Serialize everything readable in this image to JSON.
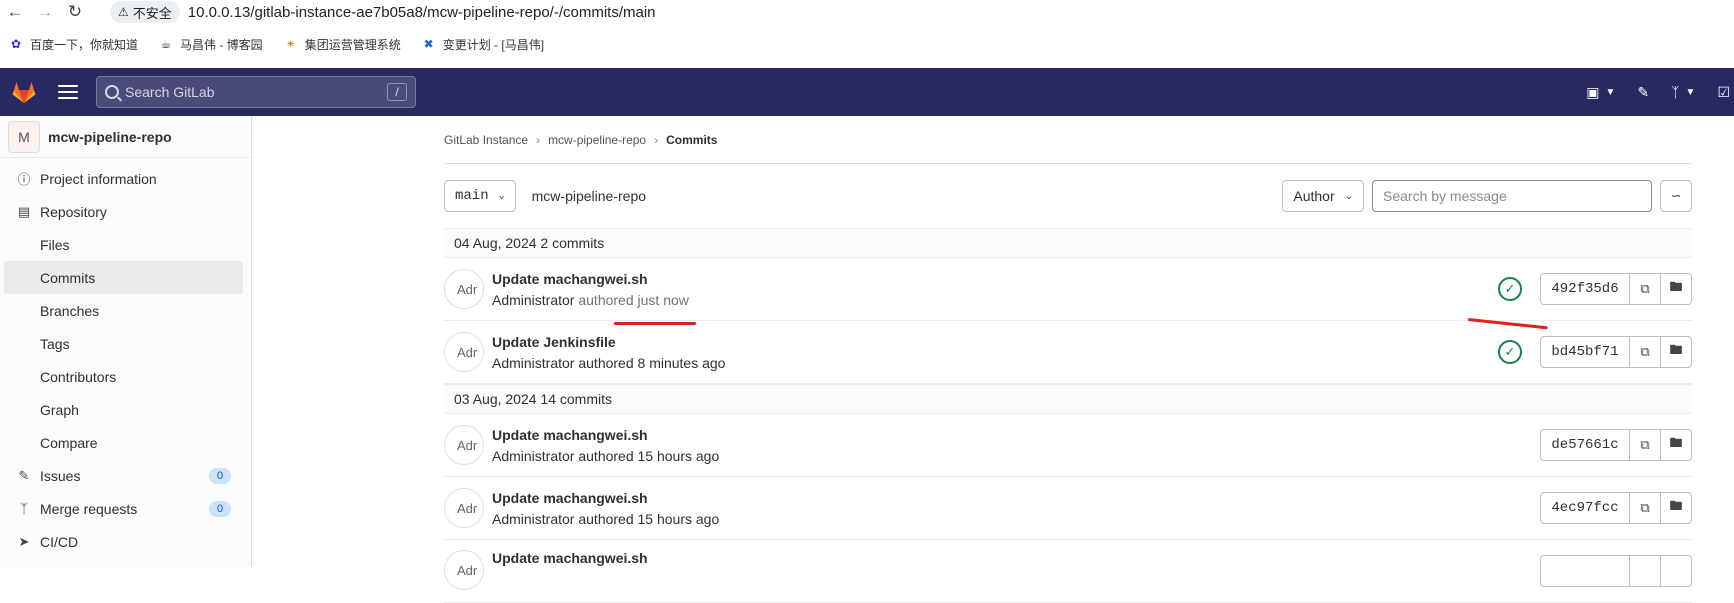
{
  "browser": {
    "insecure_label": "不安全",
    "url": "10.0.0.13/gitlab-instance-ae7b05a8/mcw-pipeline-repo/-/commits/main",
    "bookmarks": [
      {
        "label": "百度一下，你就知道",
        "icon": "baidu-paw-icon"
      },
      {
        "label": "马昌伟 - 博客园",
        "icon": "cnblogs-icon"
      },
      {
        "label": "集团运营管理系统",
        "icon": "sparkle-icon"
      },
      {
        "label": "变更计划 - [马昌伟]",
        "icon": "confluence-icon"
      }
    ]
  },
  "topbar": {
    "search_placeholder": "Search GitLab",
    "search_shortcut": "/"
  },
  "sidebar": {
    "project_initial": "M",
    "project_name": "mcw-pipeline-repo",
    "items": [
      {
        "label": "Project information",
        "type": "top",
        "icon": "info-icon"
      },
      {
        "label": "Repository",
        "type": "top",
        "icon": "book-icon"
      },
      {
        "label": "Files",
        "type": "sub"
      },
      {
        "label": "Commits",
        "type": "sub",
        "active": true
      },
      {
        "label": "Branches",
        "type": "sub"
      },
      {
        "label": "Tags",
        "type": "sub"
      },
      {
        "label": "Contributors",
        "type": "sub"
      },
      {
        "label": "Graph",
        "type": "sub"
      },
      {
        "label": "Compare",
        "type": "sub"
      },
      {
        "label": "Issues",
        "type": "top",
        "icon": "issues-icon",
        "badge": "0"
      },
      {
        "label": "Merge requests",
        "type": "top",
        "icon": "merge-request-icon",
        "badge": "0"
      },
      {
        "label": "CI/CD",
        "type": "top",
        "icon": "rocket-icon"
      }
    ]
  },
  "breadcrumb": {
    "items": [
      "GitLab Instance",
      "mcw-pipeline-repo",
      "Commits"
    ]
  },
  "filters": {
    "branch": "main",
    "path": "mcw-pipeline-repo",
    "author_label": "Author",
    "search_placeholder": "Search by message"
  },
  "commit_groups": [
    {
      "header": "04 Aug, 2024 2 commits",
      "commits": [
        {
          "title": "Update machangwei.sh",
          "author": "Administrator",
          "authored": "authored just now",
          "sha": "492f35d6",
          "pipeline": "passed",
          "avatar_alt": "Adr"
        },
        {
          "title": "Update Jenkinsfile",
          "author": "Administrator",
          "authored": "authored 8 minutes ago",
          "sha": "bd45bf71",
          "pipeline": "passed",
          "avatar_alt": "Adr"
        }
      ]
    },
    {
      "header": "03 Aug, 2024 14 commits",
      "commits": [
        {
          "title": "Update machangwei.sh",
          "author": "Administrator",
          "authored": "authored 15 hours ago",
          "sha": "de57661c",
          "pipeline": null,
          "avatar_alt": "Adr"
        },
        {
          "title": "Update machangwei.sh",
          "author": "Administrator",
          "authored": "authored 15 hours ago",
          "sha": "4ec97fcc",
          "pipeline": null,
          "avatar_alt": "Adr"
        },
        {
          "title": "Update machangwei.sh",
          "author": "",
          "authored": "",
          "sha": "",
          "pipeline": null,
          "avatar_alt": "Adr"
        }
      ]
    }
  ],
  "colors": {
    "topbar": "#292961",
    "success": "#108548",
    "annotation": "#e0201b"
  }
}
